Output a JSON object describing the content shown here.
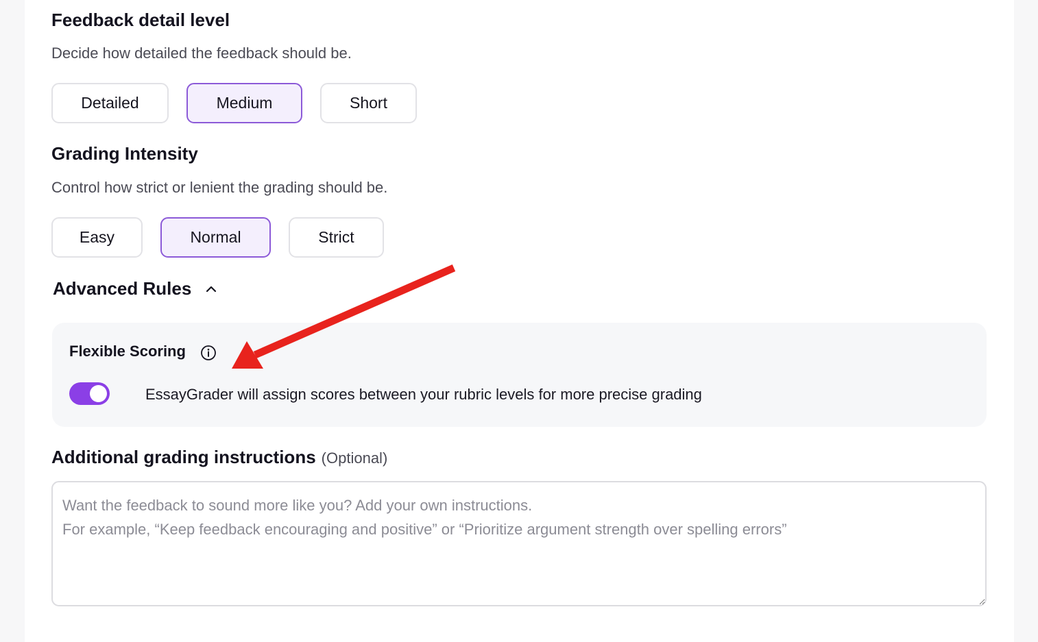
{
  "feedback": {
    "title": "Feedback detail level",
    "description": "Decide how detailed the feedback should be.",
    "options": [
      "Detailed",
      "Medium",
      "Short"
    ],
    "selected": "Medium"
  },
  "grading": {
    "title": "Grading Intensity",
    "description": "Control how strict or lenient the grading should be.",
    "options": [
      "Easy",
      "Normal",
      "Strict"
    ],
    "selected": "Normal"
  },
  "advanced": {
    "title": "Advanced Rules",
    "expanded": true,
    "flexible_scoring": {
      "title": "Flexible Scoring",
      "enabled": true,
      "description": "EssayGrader will assign scores between your rubric levels for more precise grading"
    }
  },
  "instructions": {
    "title": "Additional grading instructions",
    "optional_label": "(Optional)",
    "value": "",
    "placeholder": "Want the feedback to sound more like you? Add your own instructions.\nFor example, “Keep feedback encouraging and positive” or “Prioritize argument strength over spelling errors”"
  },
  "colors": {
    "accent": "#8b3fe6",
    "selected_border": "#8c5ad8",
    "selected_bg": "#f4effd",
    "annotation_arrow": "#e8231d"
  },
  "icons": {
    "advanced_toggle": "chevron-up-icon",
    "flexible_scoring_info": "info-icon"
  }
}
